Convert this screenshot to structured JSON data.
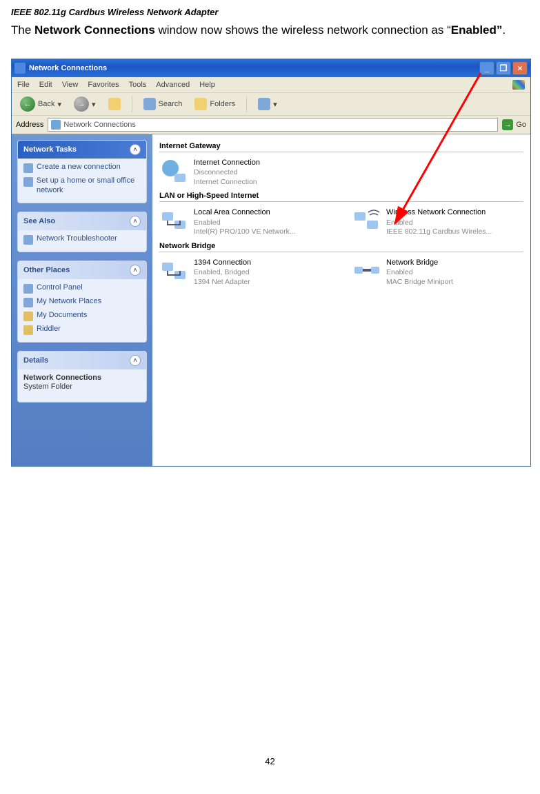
{
  "doc_title": "IEEE 802.11g Cardbus Wireless Network Adapter",
  "body_text_pre": "The ",
  "body_text_b1": "Network Connections",
  "body_text_mid": " window now shows the wireless network connection as “",
  "body_text_b2": "Enabled”",
  "body_text_post": ".",
  "page_number": "42",
  "window": {
    "title": "Network Connections",
    "menu": [
      "File",
      "Edit",
      "View",
      "Favorites",
      "Tools",
      "Advanced",
      "Help"
    ],
    "toolbar": {
      "back": "Back",
      "search": "Search",
      "folders": "Folders"
    },
    "address_label": "Address",
    "address_value": "Network Connections",
    "go_label": "Go"
  },
  "sidebar": {
    "tasks": {
      "title": "Network Tasks",
      "items": [
        "Create a new connection",
        "Set up a home or small office network"
      ]
    },
    "seealso": {
      "title": "See Also",
      "items": [
        "Network Troubleshooter"
      ]
    },
    "other": {
      "title": "Other Places",
      "items": [
        "Control Panel",
        "My Network Places",
        "My Documents",
        "Riddler"
      ]
    },
    "details": {
      "title": "Details",
      "line1": "Network Connections",
      "line2": "System Folder"
    }
  },
  "content": {
    "sec1": "Internet Gateway",
    "conn1": {
      "t1": "Internet Connection",
      "t2": "Disconnected",
      "t3": "Internet Connection"
    },
    "sec2": "LAN or High-Speed Internet",
    "conn2": {
      "t1": "Local Area Connection",
      "t2": "Enabled",
      "t3": "Intel(R) PRO/100 VE Network..."
    },
    "conn3": {
      "t1": "Wireless Network Connection",
      "t2": "Enabled",
      "t3": "IEEE 802.11g Cardbus Wireles..."
    },
    "sec3": "Network Bridge",
    "conn4": {
      "t1": "1394 Connection",
      "t2": "Enabled, Bridged",
      "t3": "1394 Net Adapter"
    },
    "conn5": {
      "t1": "Network Bridge",
      "t2": "Enabled",
      "t3": "MAC Bridge Miniport"
    }
  }
}
